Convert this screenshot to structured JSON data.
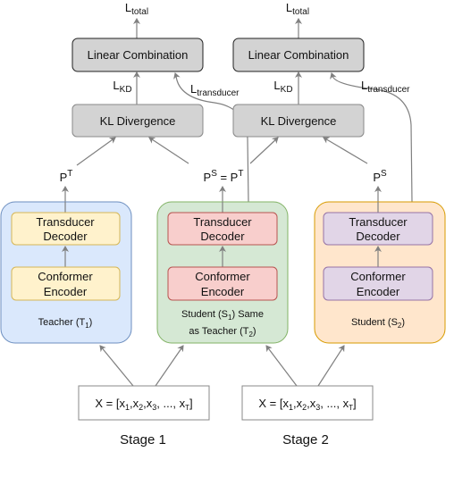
{
  "colors": {
    "teacher_fill": "#dae8fc",
    "teacher_stroke": "#6c8ebf",
    "student1_fill": "#d5e8d4",
    "student1_stroke": "#82b366",
    "student2_fill": "#ffe6cc",
    "student2_stroke": "#d79b00",
    "yellow_fill": "#fff2cc",
    "yellow_stroke": "#d6b656",
    "red_fill": "#f8cecc",
    "red_stroke": "#b85450",
    "purple_fill": "#e1d5e7",
    "purple_stroke": "#9673a6",
    "grey_fill": "#d3d3d3"
  },
  "stages": [
    {
      "label": "Stage 1",
      "loss_total": {
        "main": "L",
        "sub": "total"
      },
      "linear_combination": "Linear Combination",
      "kl_divergence": "KL Divergence",
      "loss_kd": {
        "main": "L",
        "sub": "KD"
      },
      "loss_transducer": {
        "main": "L",
        "sub": "transducer"
      },
      "input": {
        "prefix": "X = [x",
        "s1": "1",
        "c1": ",x",
        "s2": "2",
        "c2": ",x",
        "s3": "3",
        "c3": ", ..., x",
        "sT": "T",
        "end": "]"
      }
    },
    {
      "label": "Stage 2",
      "loss_total": {
        "main": "L",
        "sub": "total"
      },
      "linear_combination": "Linear Combination",
      "kl_divergence": "KL Divergence",
      "loss_kd": {
        "main": "L",
        "sub": "KD"
      },
      "loss_transducer": {
        "main": "L",
        "sub": "transducer"
      },
      "input": {
        "prefix": "X = [x",
        "s1": "1",
        "c1": ",x",
        "s2": "2",
        "c2": ",x",
        "s3": "3",
        "c3": ", ..., x",
        "sT": "T",
        "end": "]"
      }
    }
  ],
  "outputs": {
    "teacher": {
      "main": "P",
      "sup": "T"
    },
    "student1": {
      "main": "P",
      "sup": "S",
      "eq": " = P",
      "sup2": "T"
    },
    "student2": {
      "main": "P",
      "sup": "S"
    }
  },
  "models": {
    "teacher": {
      "decoder": [
        "Transducer",
        "Decoder"
      ],
      "encoder": [
        "Conformer",
        "Encoder"
      ],
      "label": {
        "pre": "Teacher (T",
        "sub": "1",
        "post": ")"
      }
    },
    "student1": {
      "decoder": [
        "Transducer",
        "Decoder"
      ],
      "encoder": [
        "Conformer",
        "Encoder"
      ],
      "label1": {
        "pre": "Student (S",
        "sub": "1",
        "post": ") Same"
      },
      "label2": {
        "pre": "as Teacher (T",
        "sub": "2",
        "post": ")"
      }
    },
    "student2": {
      "decoder": [
        "Transducer",
        "Decoder"
      ],
      "encoder": [
        "Conformer",
        "Encoder"
      ],
      "label": {
        "pre": "Student (S",
        "sub": "2",
        "post": ")"
      }
    }
  }
}
